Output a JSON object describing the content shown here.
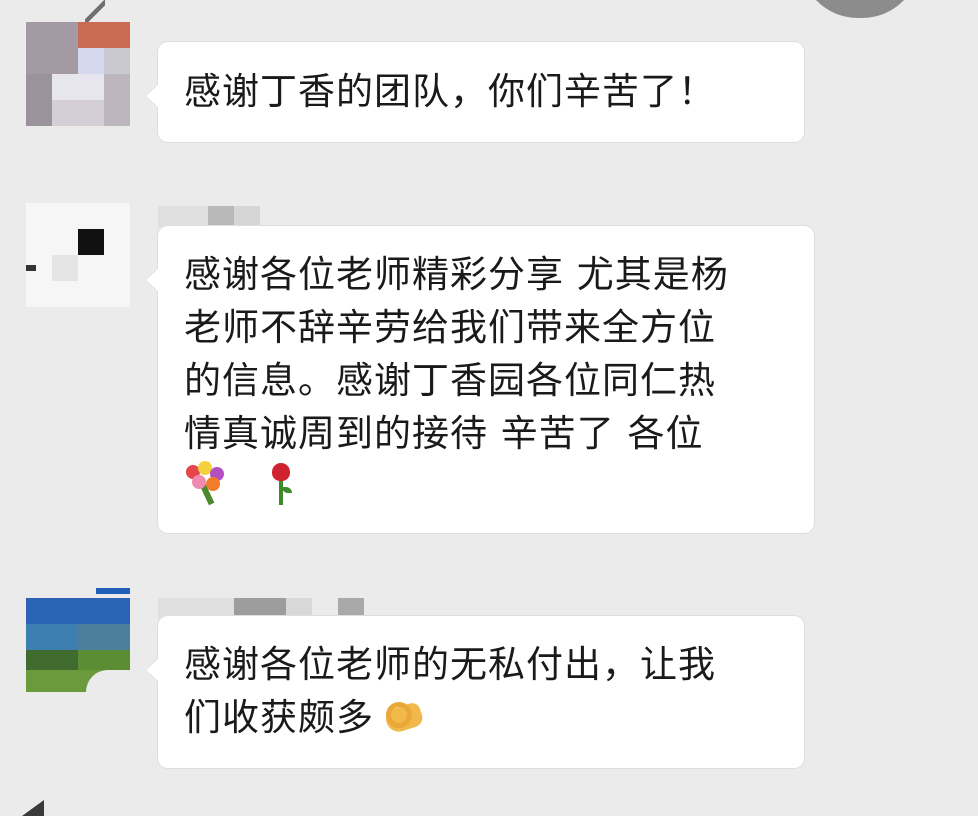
{
  "chat": {
    "messages": [
      {
        "text": "感谢丁香的团队，你们辛苦了！"
      },
      {
        "text": "感谢各位老师精彩分享 尤其是杨\n老师不辞辛劳给我们带来全方位\n的信息。感谢丁香园各位同仁热\n情真诚周到的接待 辛苦了 各位",
        "emojis": [
          "bouquet-icon",
          "rose-icon"
        ]
      },
      {
        "text": "感谢各位老师的无私付出，让我\n们收获颇多",
        "emojis": [
          "ok-hand-icon"
        ]
      }
    ]
  },
  "colors": {
    "background": "#ebebeb",
    "bubble": "#ffffff",
    "bubble_border": "#dedede",
    "text": "#1a1a1a"
  }
}
